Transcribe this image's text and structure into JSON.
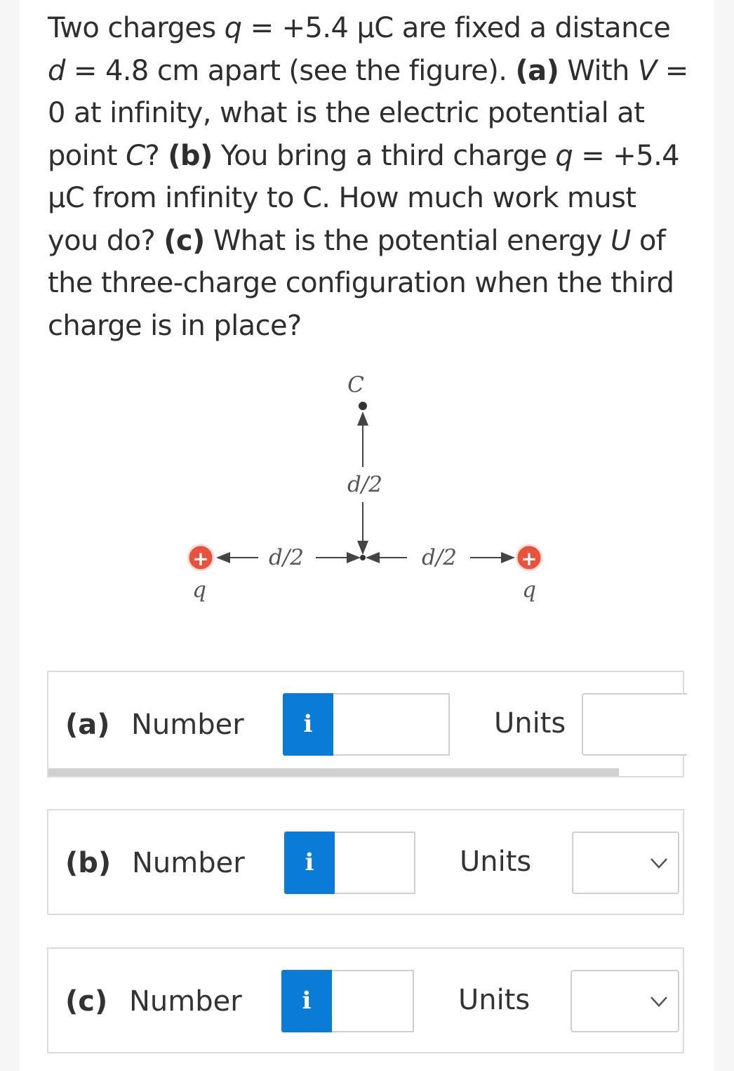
{
  "problem": {
    "p1": "Two charges ",
    "q1": "q",
    "p2": " = +5.4 μC are fixed a distance ",
    "d1": "d",
    "p3": " = 4.8 cm apart (see the figure). ",
    "a_tag": "(a)",
    "p4": " With ",
    "v1": "V",
    "p5": " = 0 at infinity, what is the electric potential at point ",
    "c1": "C",
    "p6": "? ",
    "b_tag": "(b)",
    "p7": " You bring a third charge ",
    "q2": "q",
    "p8": " = +5.4 μC from infinity to C. How much work must you do? ",
    "c_tag": "(c)",
    "p9": " What is the potential energy ",
    "u1": "U",
    "p10": " of the three-charge configuration when the third charge is in place?"
  },
  "figure": {
    "point_label": "C",
    "vertical_label": "d/2",
    "left_label": "d/2",
    "right_label": "d/2",
    "left_charge_sign": "+",
    "right_charge_sign": "+",
    "left_charge_label": "q",
    "right_charge_label": "q",
    "charge_color": "#e8523a"
  },
  "answers": {
    "a": {
      "part": "(a)",
      "number_label": "Number",
      "info": "i",
      "units_label": "Units",
      "number_value": "",
      "units_value": "",
      "progress": 0.9
    },
    "b": {
      "part": "(b)",
      "number_label": "Number",
      "info": "i",
      "units_label": "Units",
      "number_value": "",
      "units_value": ""
    },
    "c": {
      "part": "(c)",
      "number_label": "Number",
      "info": "i",
      "units_label": "Units",
      "number_value": "",
      "units_value": ""
    }
  },
  "colors": {
    "info_button": "#0a7bd6",
    "border": "#dcdcdc"
  }
}
